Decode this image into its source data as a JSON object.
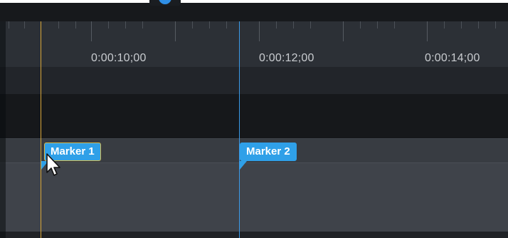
{
  "timeline": {
    "time_labels": [
      "0:00:10;00",
      "0:00:12;00",
      "0:00:14;00"
    ],
    "markers": [
      {
        "label": "Marker 1",
        "selected": true
      },
      {
        "label": "Marker 2",
        "selected": false
      }
    ]
  },
  "colors": {
    "marker_fill": "#2fa0e8",
    "selected_outline": "#d9b94a",
    "playhead_line": "#d9a73a",
    "marker_line": "#3a9ae8",
    "ruler_background": "#2c3036",
    "track_background": "#3f434a"
  },
  "icons": {
    "playhead_handle": "playhead-handle-icon",
    "cursor": "mouse-cursor-icon"
  }
}
